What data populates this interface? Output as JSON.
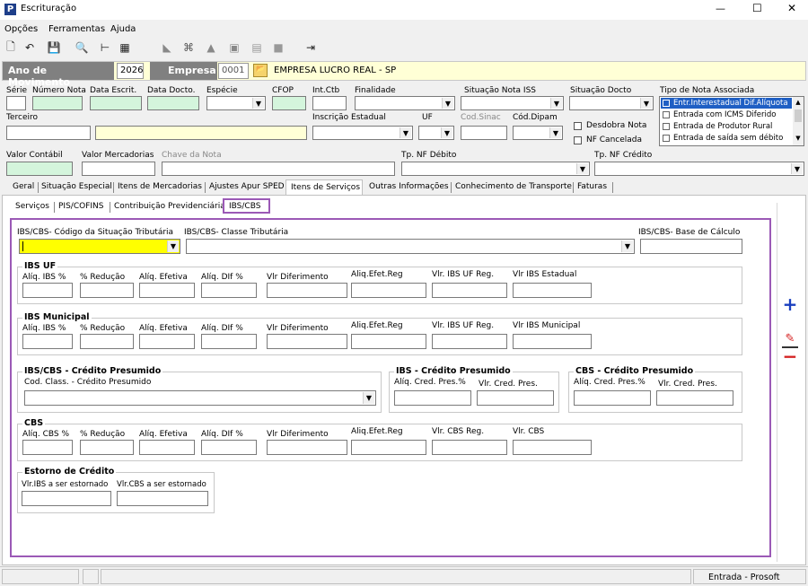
{
  "window": {
    "title": "Escrituração",
    "app_icon": "P",
    "min": "—",
    "max": "☐",
    "close": "✕"
  },
  "menu": [
    "Opções",
    "Ferramentas",
    "Ajuda"
  ],
  "header": {
    "ano_label": "Ano de Movimento",
    "ano_value": "2026",
    "empresa_label": "Empresa",
    "empresa_code": "0001",
    "empresa_name": "EMPRESA LUCRO REAL - SP"
  },
  "fields": {
    "serie": "Série",
    "numero_nota": "Número Nota",
    "data_escrit": "Data Escrit.",
    "data_docto": "Data Docto.",
    "especie": "Espécie",
    "cfop": "CFOP",
    "int_ctb": "Int.Ctb",
    "finalidade": "Finalidade",
    "situacao_iss": "Situação Nota ISS",
    "situacao_docto": "Situação Docto",
    "tipo_nota": "Tipo de Nota Associada",
    "terceiro": "Terceiro",
    "inscricao": "Inscrição Estadual",
    "uf": "UF",
    "cod_sinac": "Cod.Sinac",
    "cod_dipam": "Cód.Dipam",
    "desdobra": "Desdobra Nota",
    "nf_cancelada": "NF Cancelada",
    "valor_contabil": "Valor Contábil",
    "valor_mercadorias": "Valor Mercadorias",
    "chave_nota": "Chave da Nota",
    "tp_nf_debito": "Tp. NF Débito",
    "tp_nf_credito": "Tp. NF Crédito"
  },
  "tipo_nota_list": [
    "Entr.Interestadual Dif.Alíquota",
    "Entrada com ICMS Diferido",
    "Entrada de Produtor Rural",
    "Entrada de saída sem débito"
  ],
  "tabs_main": [
    "Geral",
    "Situação Especial",
    "Itens de Mercadorias",
    "Ajustes Apur SPED",
    "Itens de Serviços",
    "Outras Informações",
    "Conhecimento de Transporte",
    "Faturas"
  ],
  "tabs_sub": [
    "Serviços",
    "PIS/COFINS",
    "Contribuição Previdenciária",
    "IBS/CBS"
  ],
  "ibs": {
    "cst_label": "IBS/CBS- Código da Situação Tributária",
    "classe_label": "IBS/CBS- Classe Tributária",
    "base_label": "IBS/CBS- Base de Cálculo",
    "uf_title": "IBS UF",
    "uf_cols": [
      "Alíq. IBS %",
      "% Redução",
      "Alíq. Efetiva",
      "Alíq. DIf %",
      "Vlr Diferimento",
      "Aliq.Efet.Reg",
      "Vlr. IBS UF Reg.",
      "Vlr IBS Estadual"
    ],
    "mun_title": "IBS Municipal",
    "mun_cols": [
      "Alíq. IBS %",
      "% Redução",
      "Alíq. Efetiva",
      "Alíq. DIf %",
      "Vlr Diferimento",
      "Aliq.Efet.Reg",
      "Vlr. IBS UF Reg.",
      "Vlr IBS Municipal"
    ],
    "credpres_title": "IBS/CBS - Crédito Presumido",
    "credpres_label": "Cod. Class. - Crédito Presumido",
    "ibs_cred_title": "IBS - Crédito Presumido",
    "ibs_cred_cols": [
      "Alíq. Cred. Pres.%",
      "Vlr. Cred. Pres."
    ],
    "cbs_cred_title": "CBS - Crédito Presumido",
    "cbs_cred_cols": [
      "Alíq. Cred. Pres.%",
      "Vlr. Cred. Pres."
    ],
    "cbs_title": "CBS",
    "cbs_cols": [
      "Alíq. CBS %",
      "% Redução",
      "Alíq. Efetiva",
      "Alíq. DIf %",
      "Vlr Diferimento",
      "Aliq.Efet.Reg",
      "Vlr. CBS Reg.",
      "Vlr. CBS"
    ],
    "estorno_title": "Estorno de Crédito",
    "estorno_cols": [
      "Vlr.IBS a ser estornado",
      "Vlr.CBS a ser estornado"
    ]
  },
  "side_buttons": {
    "add": "+",
    "edit": "✎",
    "remove": "−"
  },
  "status": {
    "right": "Entrada - Prosoft"
  },
  "colors": {
    "header_bg": "#808080",
    "green_field": "#d4f5dc",
    "yellow_field": "#ffff00",
    "accent_border": "#9b59b6",
    "add_blue": "#1a3fbf",
    "remove_red": "#d42020"
  }
}
